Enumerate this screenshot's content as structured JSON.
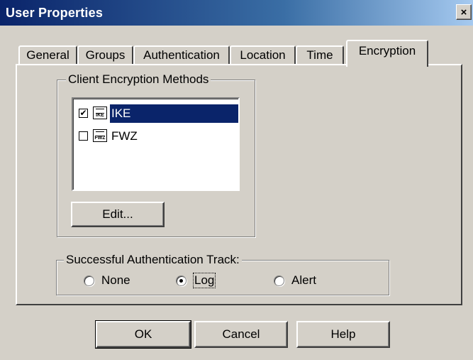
{
  "window": {
    "title": "User Properties",
    "close_label": "×"
  },
  "tabs": [
    {
      "label": "General"
    },
    {
      "label": "Groups"
    },
    {
      "label": "Authentication"
    },
    {
      "label": "Location"
    },
    {
      "label": "Time"
    },
    {
      "label": "Encryption",
      "active": true
    }
  ],
  "client_encryption": {
    "legend": "Client Encryption Methods",
    "items": [
      {
        "label": "IKE",
        "icon_text": "IKE",
        "checked": true,
        "selected": true
      },
      {
        "label": "FWZ",
        "icon_text": "FWZ",
        "checked": false,
        "selected": false
      }
    ],
    "edit_label": "Edit..."
  },
  "auth_track": {
    "legend": "Successful Authentication Track:",
    "options": [
      {
        "label": "None",
        "selected": false
      },
      {
        "label": "Log",
        "selected": true
      },
      {
        "label": "Alert",
        "selected": false
      }
    ]
  },
  "footer": {
    "ok_label": "OK",
    "cancel_label": "Cancel",
    "help_label": "Help"
  }
}
